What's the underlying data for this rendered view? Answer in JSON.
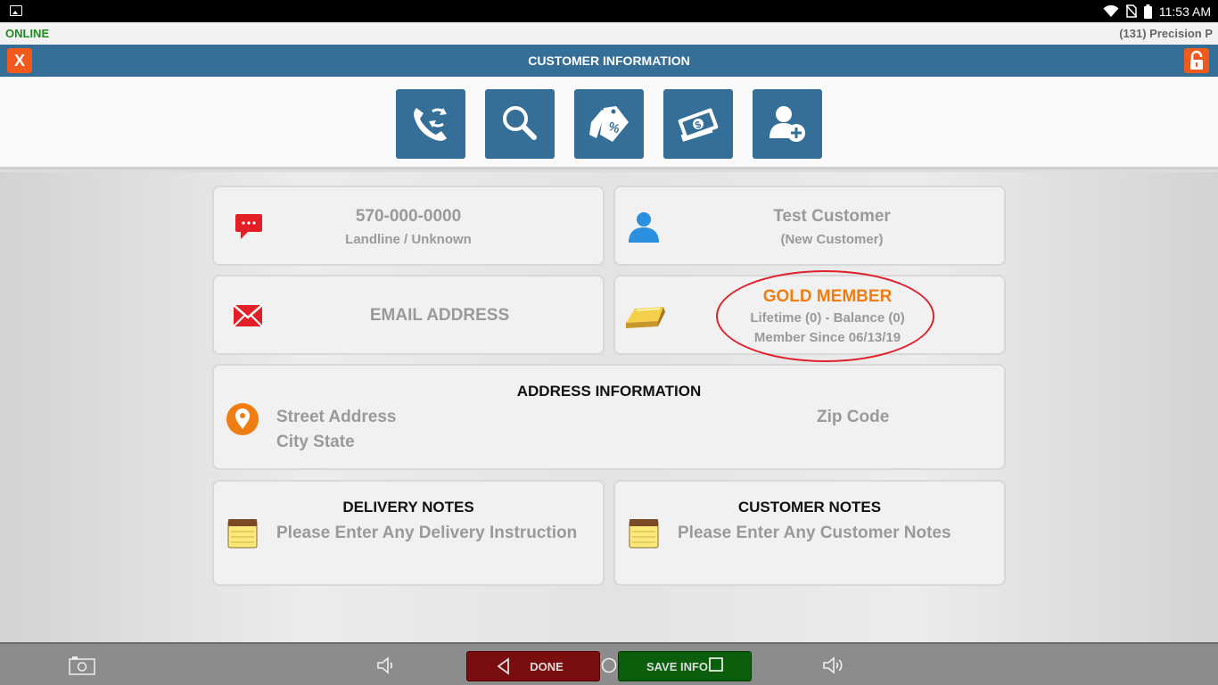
{
  "status_bar": {
    "time": "11:53 AM",
    "icons": [
      "image-icon",
      "wifi-icon",
      "no-sim-icon",
      "battery-icon"
    ]
  },
  "connection": {
    "status": "ONLINE",
    "store": "(131) Precision P"
  },
  "header": {
    "title": "CUSTOMER INFORMATION",
    "close_label": "X",
    "lock_icon": "lock-open-icon"
  },
  "toolbar": {
    "buttons": [
      {
        "icon": "phone-transfer-icon"
      },
      {
        "icon": "search-icon"
      },
      {
        "icon": "discount-tag-icon"
      },
      {
        "icon": "cash-icon"
      },
      {
        "icon": "add-user-icon"
      }
    ]
  },
  "phone": {
    "number": "570-000-0000",
    "type": "Landline / Unknown"
  },
  "customer": {
    "name": "Test Customer",
    "status": "(New Customer)"
  },
  "email": {
    "placeholder": "EMAIL ADDRESS"
  },
  "membership": {
    "level": "GOLD MEMBER",
    "summary": "Lifetime (0) - Balance (0)",
    "since": "Member Since 06/13/19"
  },
  "address": {
    "header": "ADDRESS INFORMATION",
    "street_placeholder": "Street Address",
    "city_placeholder": "City State",
    "zip_placeholder": "Zip Code"
  },
  "delivery_notes": {
    "header": "DELIVERY NOTES",
    "placeholder": "Please Enter Any Delivery Instruction"
  },
  "customer_notes": {
    "header": "CUSTOMER NOTES",
    "placeholder": "Please Enter Any Customer Notes"
  },
  "footer": {
    "done_label": "DONE",
    "save_label": "SAVE INFO"
  },
  "colors": {
    "primary": "#356f97",
    "accent_orange": "#f25a1d",
    "gold_text": "#f07d12",
    "online_green": "#1f8a1f",
    "highlight_red": "#e0202a"
  }
}
